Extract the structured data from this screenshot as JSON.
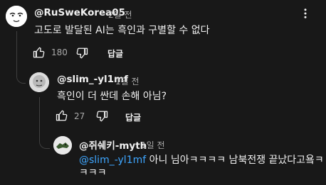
{
  "comments": [
    {
      "author": "@RuSweKorea05",
      "time": "2일 전",
      "text": "고도로 발달된 AI는 흑인과 구별할 수 없다",
      "likes": "180",
      "reply_label": "답글"
    },
    {
      "author": "@slim_-yl1mf",
      "time": "1일 전",
      "text": "흑인이 더 싼데 손해 아님?",
      "likes": "27",
      "reply_label": "답글"
    },
    {
      "author": "@쥐쉐키-myth",
      "time": "1일 전",
      "mention": "@slim_-yl1mf",
      "text_line1": " 아니 님아ㅋㅋㅋㅋ 남북전쟁 끝났다고욬ㅋ",
      "text_line2": "ㅋㅋㅋ"
    }
  ],
  "icons": {
    "like": "thumbs-up-icon",
    "dislike": "thumbs-down-icon",
    "menu": "more-vertical-icon"
  },
  "colors": {
    "background": "#181818",
    "text": "#f1f1f1",
    "secondary": "#aaaaaa",
    "mention": "#3ea6ff"
  }
}
